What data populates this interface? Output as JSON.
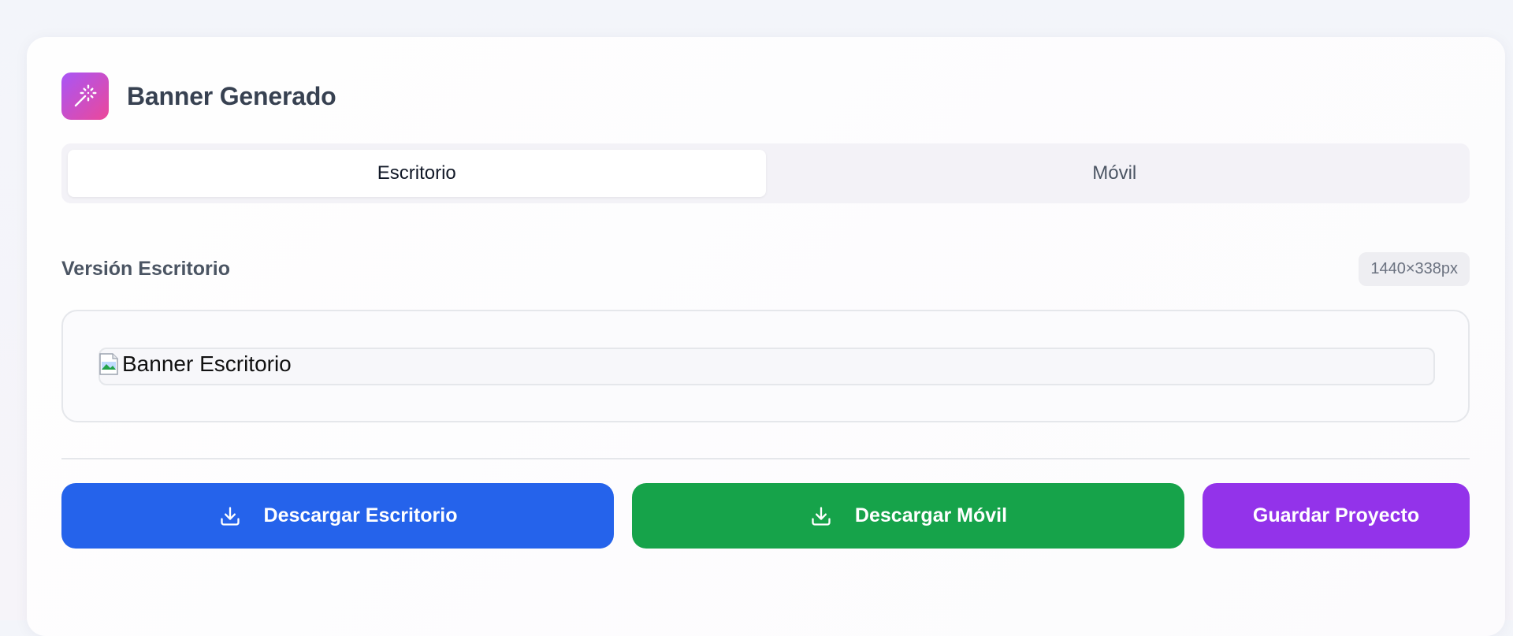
{
  "header": {
    "title": "Banner Generado",
    "icon": "magic-wand-icon",
    "icon_gradient": [
      "#a855f7",
      "#ec4899"
    ]
  },
  "tabs": [
    {
      "label": "Escritorio",
      "active": true
    },
    {
      "label": "Móvil",
      "active": false
    }
  ],
  "version": {
    "label": "Versión Escritorio",
    "dimensions": "1440×338px"
  },
  "preview": {
    "image_alt": "Banner Escritorio",
    "broken_icon": "broken-image-icon"
  },
  "actions": {
    "download_desktop": {
      "label": "Descargar Escritorio",
      "icon": "download-icon",
      "color": "#2563eb"
    },
    "download_mobile": {
      "label": "Descargar Móvil",
      "icon": "download-icon",
      "color": "#16a34a"
    },
    "save_project": {
      "label": "Guardar Proyecto",
      "color": "#9333ea"
    }
  }
}
